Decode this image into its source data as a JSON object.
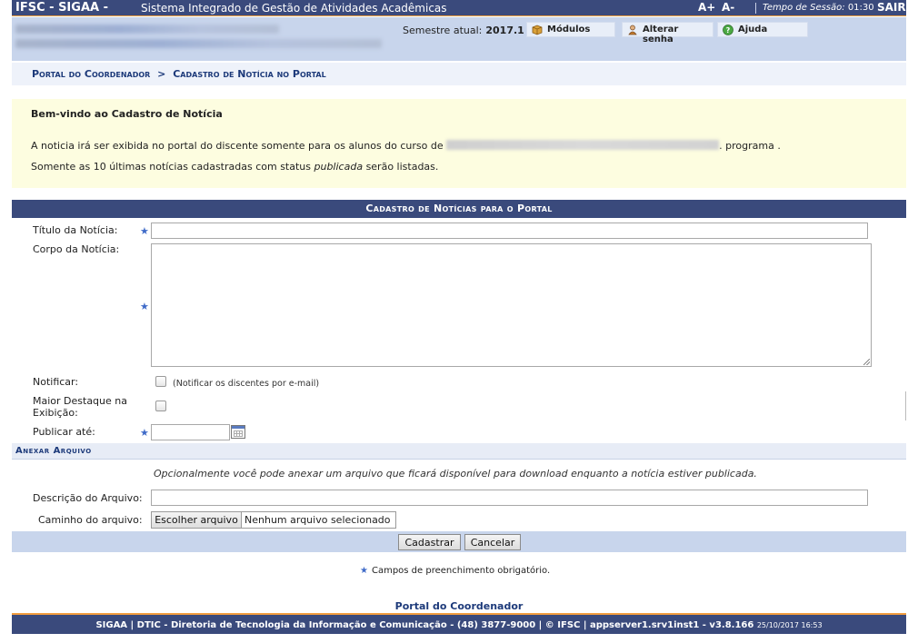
{
  "topbar": {
    "brand": "IFSC - SIGAA -",
    "system_name": "Sistema Integrado de Gestão de Atividades Acadêmicas",
    "font_increase": "A+",
    "font_decrease": "A-",
    "session_label": "Tempo de Sessão:",
    "session_time": "01:30",
    "logout": "SAIR"
  },
  "infobar": {
    "semester_label": "Semestre atual:",
    "semester_value": "2017.1",
    "menu": [
      {
        "label": "Módulos",
        "icon": "box-icon"
      },
      {
        "label": "Alterar senha",
        "icon": "user-key-icon"
      },
      {
        "label": "Ajuda",
        "icon": "help-icon"
      }
    ]
  },
  "breadcrumb": {
    "parent": "Portal do Coordenador",
    "separator": ">",
    "current": "Cadastro de Notícia no Portal"
  },
  "welcome": {
    "title": "Bem-vindo ao Cadastro de Notícia",
    "line1_before": "A noticia irá ser exibida no portal do discente somente para os alunos do curso de",
    "line1_after": ". programa .",
    "line2_before": "Somente as 10 últimas notícias cadastradas com status",
    "line2_emph": "publicada",
    "line2_after": "serão listadas."
  },
  "form": {
    "caption": "Cadastro de Notícias para o Portal",
    "required_marker": "★",
    "title_label": "Título da Notícia:",
    "title_value": "",
    "body_label": "Corpo da Notícia:",
    "body_value": "",
    "notify_label": "Notificar:",
    "notify_note": "(Notificar os discentes por e-mail)",
    "highlight_label_1": "Maior Destaque na",
    "highlight_label_2": "Exibição:",
    "publish_label": "Publicar até:",
    "publish_value": ""
  },
  "attachment": {
    "section_title": "Anexar Arquivo",
    "note": "Opcionalmente você pode anexar um arquivo que ficará disponível para download enquanto a notícia estiver publicada.",
    "description_label": "Descrição do Arquivo:",
    "description_value": "",
    "path_label": "Caminho do arquivo:",
    "choose_button": "Escolher arquivo",
    "no_file": "Nenhum arquivo selecionado"
  },
  "actions": {
    "submit": "Cadastrar",
    "cancel": "Cancelar"
  },
  "required_note": "Campos de preenchimento obrigatório.",
  "portal_link": "Portal do Coordenador",
  "footer": {
    "text": "SIGAA | DTIC - Diretoria de Tecnologia da Informação e Comunicação - (48) 3877-9000 | © IFSC | appserver1.srv1inst1 - v3.8.166",
    "stamp": "25/10/2017 16:53"
  },
  "colors": {
    "header_blue": "#3a4a7c",
    "accent_orange": "#f29d3f",
    "link_blue": "#1d3a7a",
    "info_yellow": "#fdfde0",
    "required_star": "#3f6bc8"
  }
}
